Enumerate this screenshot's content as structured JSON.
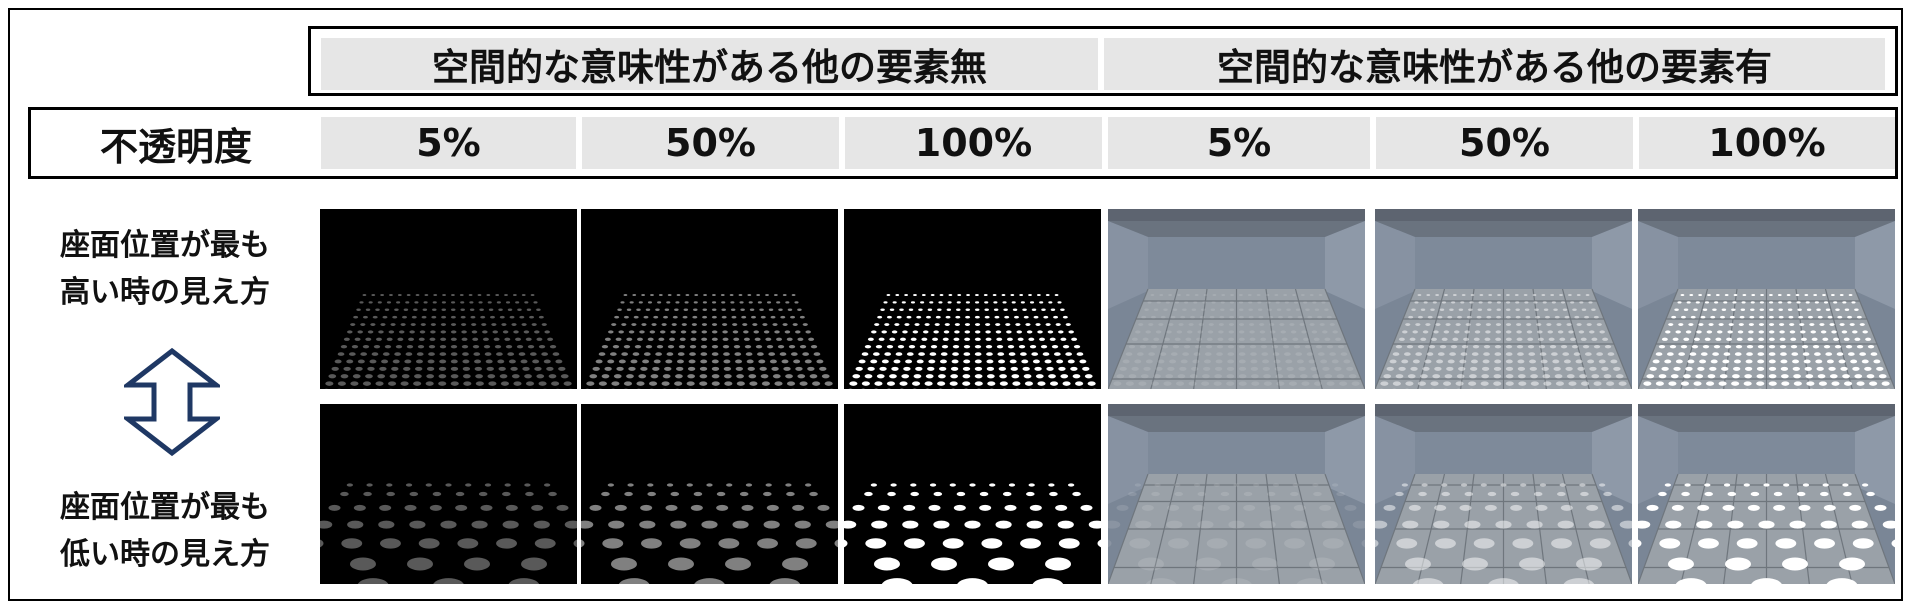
{
  "conditions": [
    {
      "label": "空間的な意味性がある他の要素無",
      "background": "black"
    },
    {
      "label": "空間的な意味性がある他の要素有",
      "background": "room"
    }
  ],
  "opacity_header": "不透明度",
  "opacities": [
    "5%",
    "50%",
    "100%",
    "5%",
    "50%",
    "100%"
  ],
  "rows": [
    {
      "label_line1": "座面位置が最も",
      "label_line2": "高い時の見え方",
      "view": "high"
    },
    {
      "label_line1": "座面位置が最も",
      "label_line2": "低い時の見え方",
      "view": "low"
    }
  ],
  "opacity_levels": [
    0.05,
    0.5,
    1.0
  ],
  "colors": {
    "header_bg": "#e6e6e6",
    "border": "#000000",
    "arrow": "#1f3864",
    "room_wall": "#7c8898",
    "floor_tile": "#8e969e"
  }
}
